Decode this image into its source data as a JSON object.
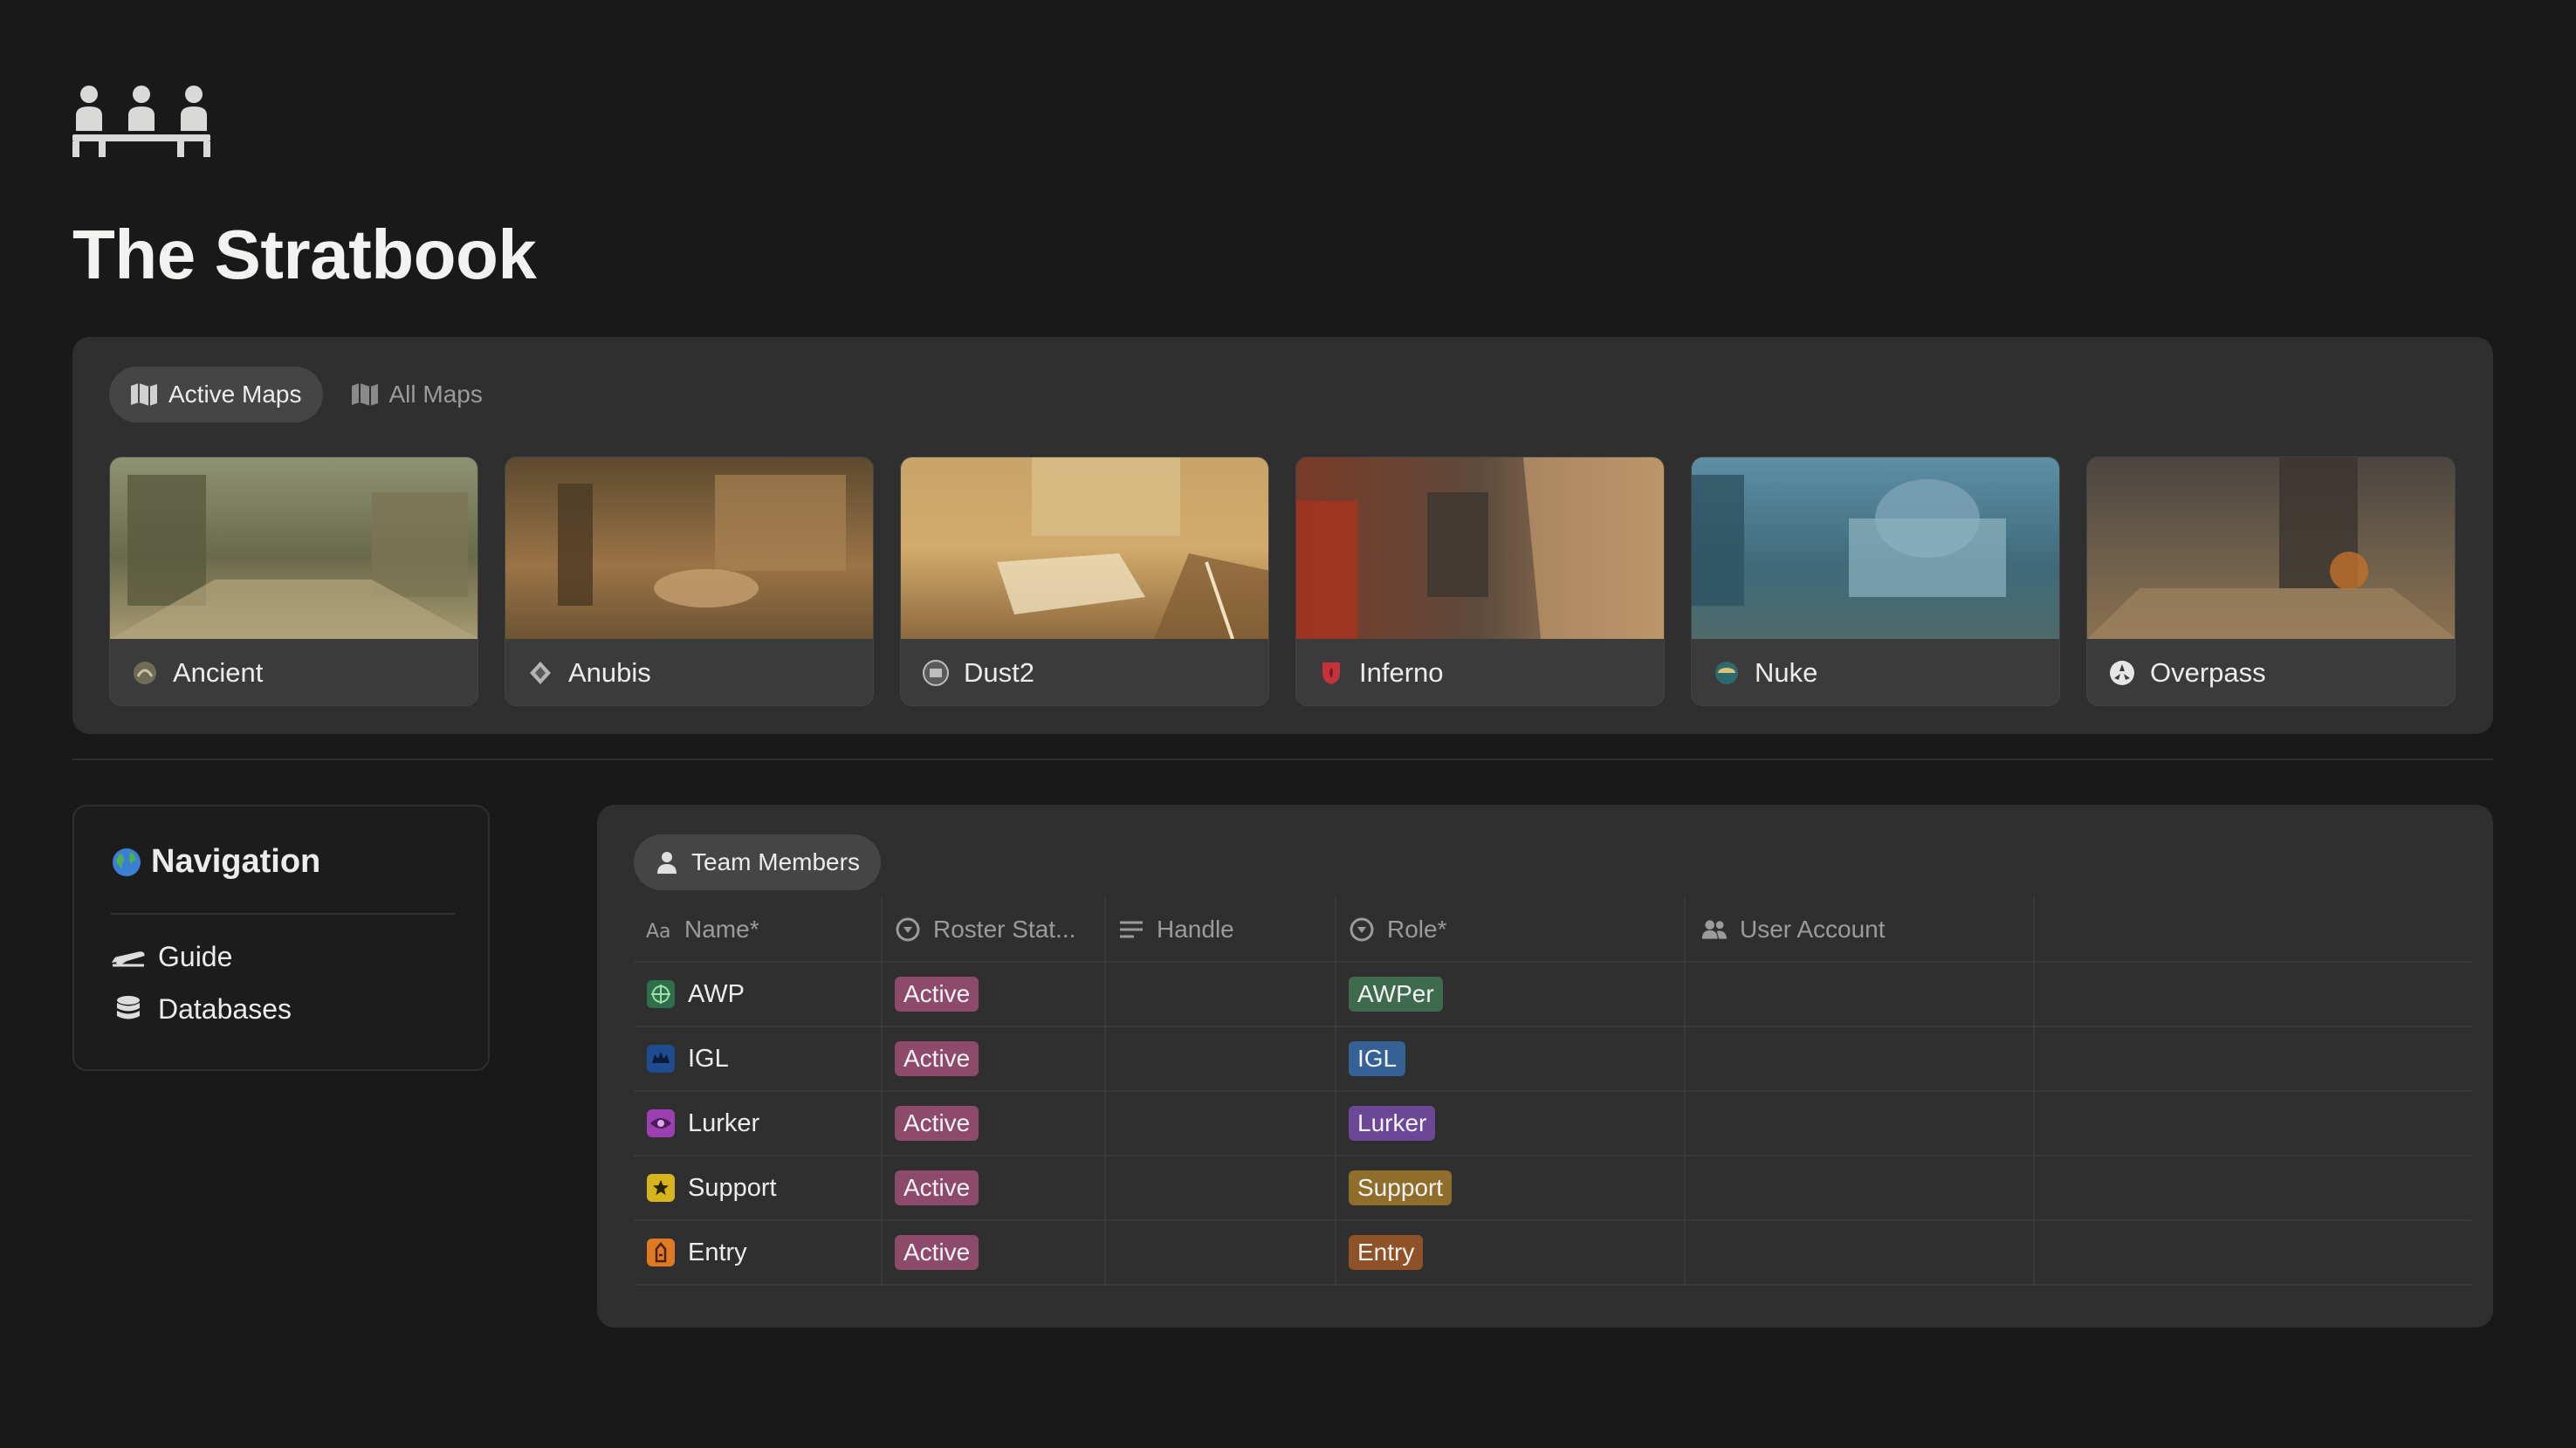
{
  "page": {
    "icon": "team-meeting-icon",
    "title": "The Stratbook"
  },
  "maps": {
    "tabs": [
      {
        "label": "Active Maps",
        "icon": "map-icon",
        "selected": true
      },
      {
        "label": "All Maps",
        "icon": "map-icon",
        "selected": false
      }
    ],
    "cards": [
      {
        "name": "Ancient",
        "icon": "ancient-map-icon",
        "color": "#6b6a52"
      },
      {
        "name": "Anubis",
        "icon": "anubis-map-icon",
        "color": "#7a5a34"
      },
      {
        "name": "Dust2",
        "icon": "dust2-map-icon",
        "color": "#b07e44"
      },
      {
        "name": "Inferno",
        "icon": "inferno-map-icon",
        "color": "#8a5a3c"
      },
      {
        "name": "Nuke",
        "icon": "nuke-map-icon",
        "color": "#3f6a7e"
      },
      {
        "name": "Overpass",
        "icon": "overpass-map-icon",
        "color": "#5b5142"
      }
    ]
  },
  "navigation": {
    "title": "Navigation",
    "icon": "globe-icon",
    "items": [
      {
        "label": "Guide",
        "icon": "airplane-icon"
      },
      {
        "label": "Databases",
        "icon": "database-icon"
      }
    ]
  },
  "team": {
    "tab_label": "Team Members",
    "tab_icon": "person-icon",
    "columns": [
      {
        "label": "Name*",
        "icon": "text-property-icon"
      },
      {
        "label": "Roster Stat...",
        "icon": "status-property-icon"
      },
      {
        "label": "Handle",
        "icon": "text-lines-icon"
      },
      {
        "label": "Role*",
        "icon": "status-property-icon"
      },
      {
        "label": "User Account",
        "icon": "people-icon"
      },
      {
        "label": "",
        "icon": ""
      }
    ],
    "rows": [
      {
        "name": "AWP",
        "icon": "awp-icon",
        "status": "Active",
        "handle": "",
        "role": "AWPer",
        "role_color": "#3e6b4d",
        "user": ""
      },
      {
        "name": "IGL",
        "icon": "igl-icon",
        "status": "Active",
        "handle": "",
        "role": "IGL",
        "role_color": "#356197",
        "user": ""
      },
      {
        "name": "Lurker",
        "icon": "lurker-icon",
        "status": "Active",
        "handle": "",
        "role": "Lurker",
        "role_color": "#6c4796",
        "user": ""
      },
      {
        "name": "Support",
        "icon": "support-icon",
        "status": "Active",
        "handle": "",
        "role": "Support",
        "role_color": "#8f6d2a",
        "user": ""
      },
      {
        "name": "Entry",
        "icon": "entry-icon",
        "status": "Active",
        "handle": "",
        "role": "Entry",
        "role_color": "#8f5226",
        "user": ""
      }
    ]
  }
}
